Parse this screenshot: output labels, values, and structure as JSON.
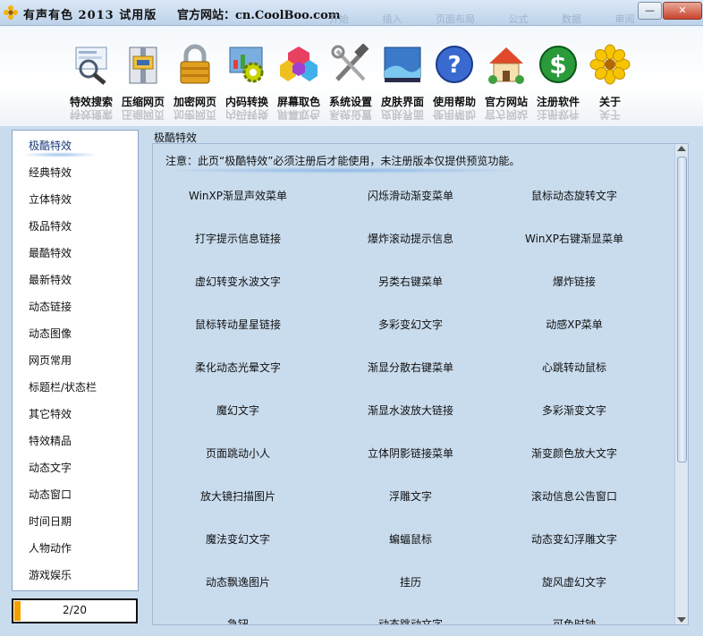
{
  "window": {
    "title": "有声有色 2013 试用版",
    "site": "官方网站：cn.CoolBoo.com",
    "ghost_tabs": [
      "开始",
      "插入",
      "页面布局",
      "公式",
      "数据",
      "审阅"
    ],
    "minimize_glyph": "—",
    "close_glyph": "✕"
  },
  "toolbar": {
    "items": [
      {
        "label": "特效搜索",
        "icon": "magnifier-icon"
      },
      {
        "label": "压缩网页",
        "icon": "compress-icon"
      },
      {
        "label": "加密网页",
        "icon": "lock-icon"
      },
      {
        "label": "内码转换",
        "icon": "gear-chart-icon"
      },
      {
        "label": "屏幕取色",
        "icon": "color-picker-icon"
      },
      {
        "label": "系统设置",
        "icon": "tools-icon"
      },
      {
        "label": "皮肤界面",
        "icon": "skin-icon"
      },
      {
        "label": "使用帮助",
        "icon": "help-icon"
      },
      {
        "label": "官方网站",
        "icon": "house-icon"
      },
      {
        "label": "注册软件",
        "icon": "dollar-icon"
      },
      {
        "label": "关于",
        "icon": "flower-icon"
      }
    ]
  },
  "nav": {
    "items": [
      "极酷特效",
      "经典特效",
      "立体特效",
      "极品特效",
      "最酷特效",
      "最新特效",
      "动态链接",
      "动态图像",
      "网页常用",
      "标题栏/状态栏",
      "其它特效",
      "特效精品",
      "动态文字",
      "动态窗口",
      "时间日期",
      "人物动作",
      "游戏娱乐"
    ],
    "active_index": 0
  },
  "pager": {
    "text": "2/20",
    "progress": 0.05
  },
  "panel": {
    "title": "极酷特效",
    "notice": "注意：此页“极酷特效”必须注册后才能使用，未注册版本仅提供预览功能。",
    "rows": [
      [
        "WinXP渐显声效菜单",
        "闪烁滑动渐变菜单",
        "鼠标动态旋转文字"
      ],
      [
        "打字提示信息链接",
        "爆炸滚动提示信息",
        "WinXP右键渐显菜单"
      ],
      [
        "虚幻转变水波文字",
        "另类右键菜单",
        "爆炸链接"
      ],
      [
        "鼠标转动星星链接",
        "多彩变幻文字",
        "动感XP菜单"
      ],
      [
        "柔化动态光晕文字",
        "渐显分散右键菜单",
        "心跳转动鼠标"
      ],
      [
        "魔幻文字",
        "渐显水波放大链接",
        "多彩渐变文字"
      ],
      [
        "页面跳动小人",
        "立体阴影链接菜单",
        "渐变颜色放大文字"
      ],
      [
        "放大镜扫描图片",
        "浮雕文字",
        "滚动信息公告窗口"
      ],
      [
        "魔法变幻文字",
        "蝙蝠鼠标",
        "动态变幻浮雕文字"
      ],
      [
        "动态飘逸图片",
        "挂历",
        "旋风虚幻文字"
      ],
      [
        "急钮",
        "动态跳动文字",
        "可色时钟"
      ]
    ]
  }
}
